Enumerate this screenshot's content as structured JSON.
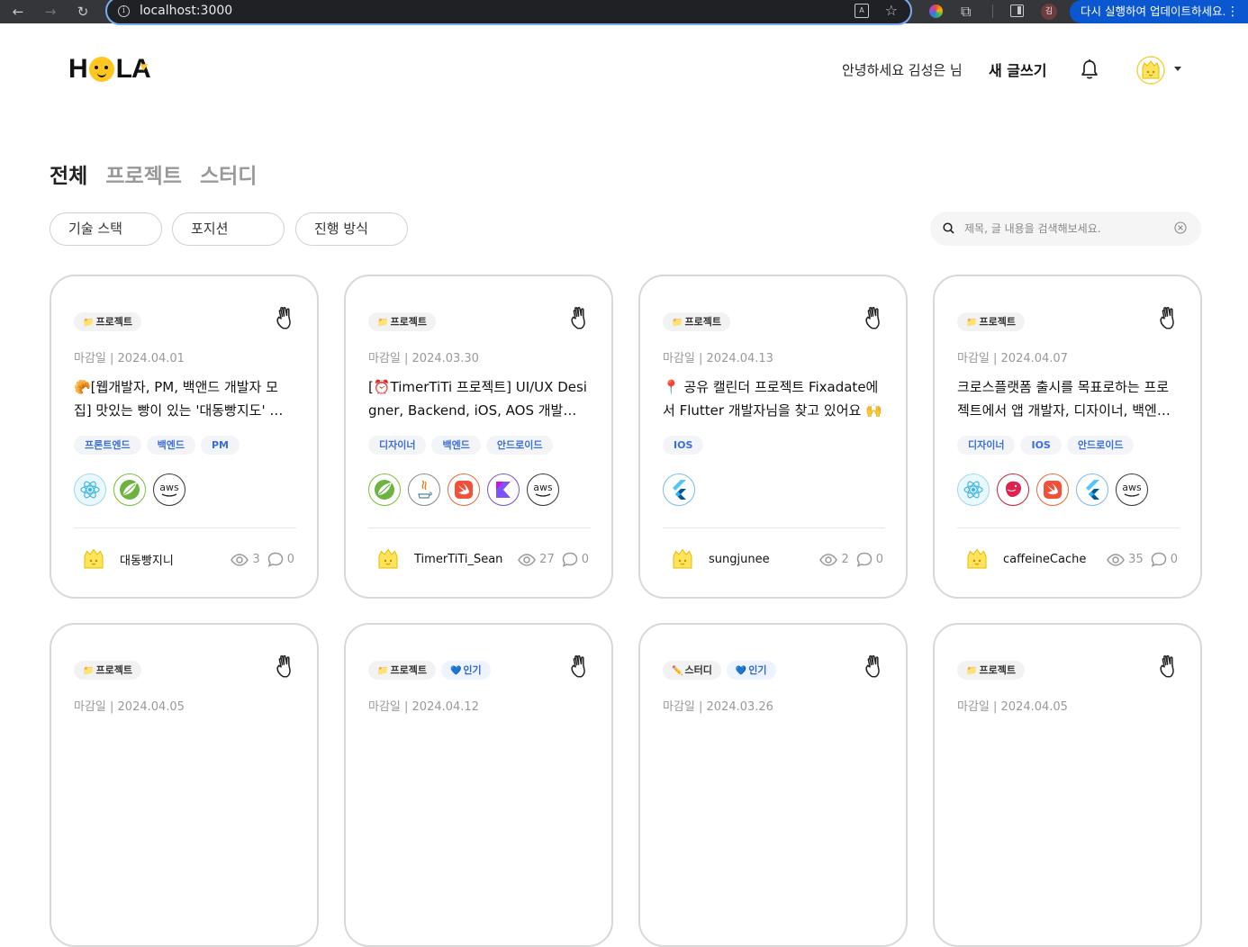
{
  "browser": {
    "url": "localhost:3000",
    "profile_initial": "김",
    "update_label": "다시 실행하여 업데이트하세요.",
    "info_glyph": "i",
    "translate_glyph": "A",
    "menu_dots": "⋮"
  },
  "header": {
    "logo": {
      "h": "H",
      "l": "L",
      "a": "A"
    },
    "greeting": "안녕하세요 김성은 님",
    "write_label": "새 글쓰기"
  },
  "tabs": [
    "전체",
    "프로젝트",
    "스터디"
  ],
  "filters": [
    "기술 스택",
    "포지션",
    "진행 방식"
  ],
  "search": {
    "placeholder": "제목, 글 내용을 검색해보세요."
  },
  "colors": {
    "accent": "#ffc71e",
    "position_text": "#3a6fd8",
    "muted": "#999999"
  },
  "cards": [
    {
      "badges": [
        {
          "icon": "📁",
          "label": "프로젝트"
        }
      ],
      "deadline": "마감일 | 2024.04.01",
      "title": "🥐[웹개발자, PM, 백앤드 개발자 모집] 맛있는 빵이 있는 '대동빵지도' 사이드 프로젝트",
      "positions": [
        "프론트엔드",
        "백엔드",
        "PM"
      ],
      "stacks": [
        "react-icon",
        "spring-icon",
        "aws-icon"
      ],
      "author": "대동빵지니",
      "views": "3",
      "comments": "0"
    },
    {
      "badges": [
        {
          "icon": "📁",
          "label": "프로젝트"
        }
      ],
      "deadline": "마감일 | 2024.03.30",
      "title": "[⏰TimerTiTi 프로젝트] UI/UX Designer, Backend, iOS, AOS 개발자를 모집합니다",
      "positions": [
        "디자이너",
        "백엔드",
        "안드로이드"
      ],
      "stacks": [
        "spring-icon",
        "java-icon",
        "swift-icon",
        "kotlin-icon",
        "aws-icon"
      ],
      "author": "TimerTiTi_Sean",
      "views": "27",
      "comments": "0"
    },
    {
      "badges": [
        {
          "icon": "📁",
          "label": "프로젝트"
        }
      ],
      "deadline": "마감일 | 2024.04.13",
      "title": "📍 공유 캘린더 프로젝트 Fixadate에서 Flutter 개발자님을 찾고 있어요 🙌",
      "positions": [
        "IOS"
      ],
      "stacks": [
        "flutter-icon"
      ],
      "author": "sungjunee",
      "views": "2",
      "comments": "0"
    },
    {
      "badges": [
        {
          "icon": "📁",
          "label": "프로젝트"
        }
      ],
      "deadline": "마감일 | 2024.04.07",
      "title": "크로스플랫폼 출시를 목표로하는 프로젝트에서 앱 개발자, 디자이너, 백엔드 개발자를 모집합니다",
      "positions": [
        "디자이너",
        "IOS",
        "안드로이드"
      ],
      "stacks": [
        "react-icon",
        "nestjs-icon",
        "swift-icon",
        "flutter-icon",
        "aws-icon"
      ],
      "author": "caffeineCache",
      "views": "35",
      "comments": "0"
    },
    {
      "badges": [
        {
          "icon": "📁",
          "label": "프로젝트"
        }
      ],
      "deadline": "마감일 | 2024.04.05"
    },
    {
      "badges": [
        {
          "icon": "📁",
          "label": "프로젝트"
        },
        {
          "icon": "💙",
          "label": "인기",
          "hot": true
        }
      ],
      "deadline": "마감일 | 2024.04.12"
    },
    {
      "badges": [
        {
          "icon": "✏️",
          "label": "스터디"
        },
        {
          "icon": "💙",
          "label": "인기",
          "hot": true
        }
      ],
      "deadline": "마감일 | 2024.03.26"
    },
    {
      "badges": [
        {
          "icon": "📁",
          "label": "프로젝트"
        }
      ],
      "deadline": "마감일 | 2024.04.05"
    }
  ]
}
